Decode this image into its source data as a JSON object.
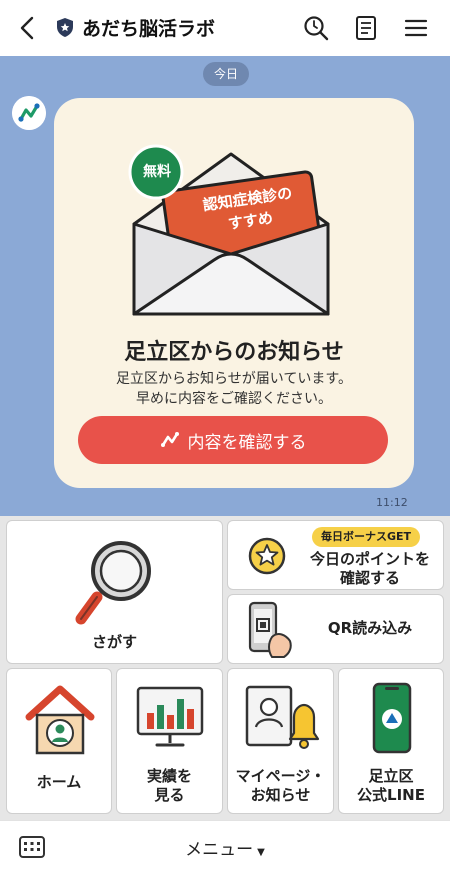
{
  "header": {
    "title": "あだち脳活ラボ",
    "icons": [
      "chevron-left-icon",
      "shield-icon",
      "search-icon",
      "note-icon",
      "menu-icon"
    ]
  },
  "chat": {
    "date_label": "今日",
    "timestamp": "11:12",
    "message": {
      "envelope_badge": "無料",
      "envelope_card_line1": "認知症検診の",
      "envelope_card_line2": "すすめ",
      "title": "足立区からのお知らせ",
      "body_line1": "足立区からお知らせが届いています。",
      "body_line2": "早めに内容をご確認ください。",
      "button_label": "内容を確認する"
    }
  },
  "rich_menu": {
    "search": "さがす",
    "bonus_badge": "毎日ボーナスGET",
    "points_line1": "今日のポイントを",
    "points_line2": "確認する",
    "qr": "QR読み込み",
    "home": "ホーム",
    "results_line1": "実績を",
    "results_line2": "見る",
    "mypage_line1": "マイページ・",
    "mypage_line2": "お知らせ",
    "adachi_line1": "足立区",
    "adachi_line2": "公式LINE"
  },
  "footer": {
    "menu_label": "メニュー",
    "caret": "▼"
  },
  "colors": {
    "chat_background": "#8ba9d6",
    "bubble": "#faf3e3",
    "accent_red": "#e8524a",
    "badge_yellow": "#f6d048",
    "brand_green": "#1e9a68"
  }
}
